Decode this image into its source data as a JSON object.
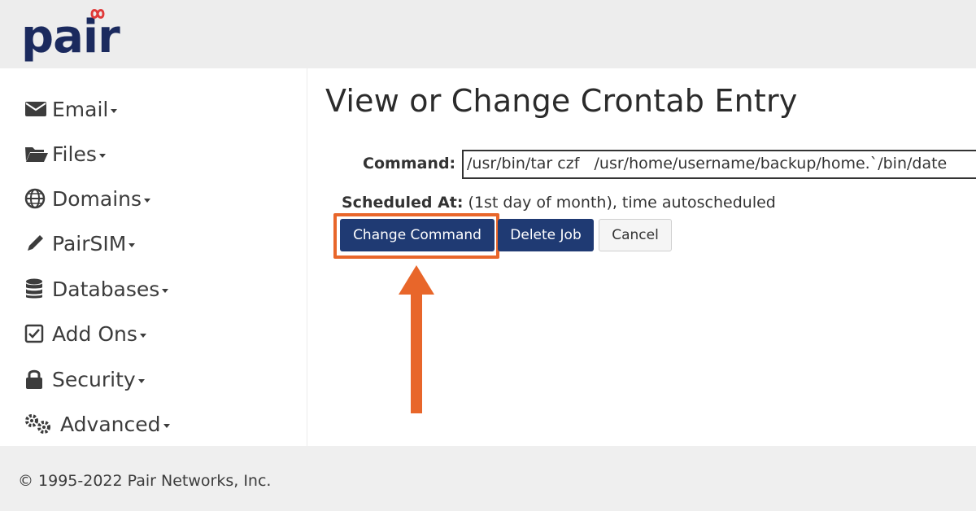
{
  "brand": {
    "logo_text": "pair",
    "color": "#1b2a5e",
    "accent": "#e8662a"
  },
  "sidebar": {
    "items": [
      {
        "label": "Email",
        "icon": "envelope-icon"
      },
      {
        "label": "Files",
        "icon": "folder-open-icon"
      },
      {
        "label": "Domains",
        "icon": "globe-icon"
      },
      {
        "label": "PairSIM",
        "icon": "pencil-icon"
      },
      {
        "label": "Databases",
        "icon": "database-icon"
      },
      {
        "label": "Add Ons",
        "icon": "checkbox-icon"
      },
      {
        "label": "Security",
        "icon": "lock-icon"
      },
      {
        "label": "Advanced",
        "icon": "gears-icon"
      }
    ]
  },
  "main": {
    "title": "View or Change Crontab Entry",
    "command_label": "Command:",
    "command_value": "/usr/bin/tar czf   /usr/home/username/backup/home.`/bin/date",
    "scheduled_label": "Scheduled At:",
    "scheduled_value": "(1st day of month), time autoscheduled",
    "buttons": {
      "change": "Change Command",
      "delete": "Delete Job",
      "cancel": "Cancel"
    },
    "annotation": {
      "type": "arrow-up",
      "color": "#e8662a",
      "target": "change-command-button"
    }
  },
  "footer": {
    "copyright": "© 1995-2022 Pair Networks, Inc."
  }
}
